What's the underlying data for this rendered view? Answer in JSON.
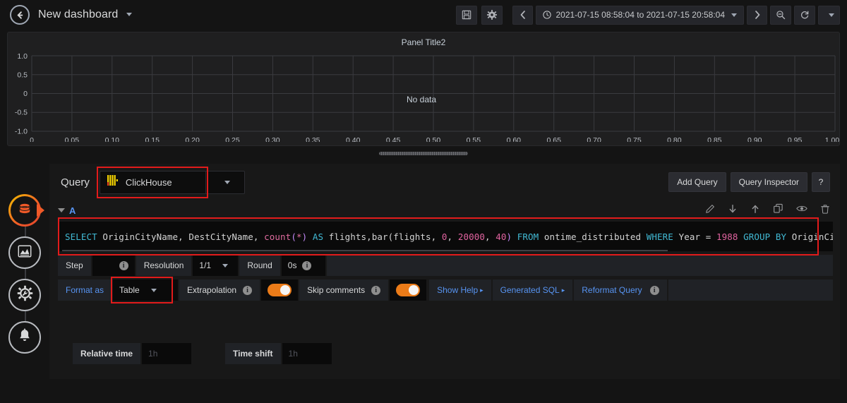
{
  "navbar": {
    "back_icon": "arrow-left-circle-icon",
    "dashboard_title": "New dashboard",
    "save_icon": "save-disk-icon",
    "settings_icon": "gear-icon",
    "prev_range_icon": "chevron-left-icon",
    "next_range_icon": "chevron-right-icon",
    "zoom_out_icon": "search-minus-icon",
    "refresh_icon": "refresh-icon",
    "refresh_caret_icon": "chevron-down-icon",
    "time_range": "2021-07-15 08:58:04 to 2021-07-15 20:58:04",
    "time_icon": "clock-icon"
  },
  "panel": {
    "title": "Panel Title2",
    "nodata": "No data"
  },
  "chart_data": {
    "type": "line",
    "title": "Panel Title2",
    "series": [],
    "x": [],
    "xlabel": "",
    "ylabel": "",
    "xlim": [
      0,
      1.0
    ],
    "ylim": [
      -1.0,
      1.0
    ],
    "xticks": [
      "0",
      "0.05",
      "0.10",
      "0.15",
      "0.20",
      "0.25",
      "0.30",
      "0.35",
      "0.40",
      "0.45",
      "0.50",
      "0.55",
      "0.60",
      "0.65",
      "0.70",
      "0.75",
      "0.80",
      "0.85",
      "0.90",
      "0.95",
      "1.00"
    ],
    "yticks": [
      "1.0",
      "0.5",
      "0",
      "-0.5",
      "-1.0"
    ],
    "grid": true,
    "legend": "none",
    "annotation": "No data"
  },
  "rail": {
    "items": [
      {
        "icon": "database-icon",
        "name": "queries-tab",
        "active": true
      },
      {
        "icon": "visualization-chart-icon",
        "name": "visualization-tab",
        "active": false
      },
      {
        "icon": "gear-wrench-icon",
        "name": "general-settings-tab",
        "active": false
      },
      {
        "icon": "bell-icon",
        "name": "alert-tab",
        "active": false
      }
    ]
  },
  "query": {
    "label": "Query",
    "datasource": "ClickHouse",
    "datasource_icon": "clickhouse-logo-icon",
    "datasource_caret_icon": "chevron-down-icon",
    "add_query": "Add Query",
    "query_inspector": "Query Inspector",
    "help": "?",
    "row": {
      "name": "A",
      "collapse_icon": "chevron-down-icon",
      "actions": [
        {
          "icon": "pencil-icon",
          "name": "edit-query-icon"
        },
        {
          "icon": "arrow-down-icon",
          "name": "move-query-down-icon"
        },
        {
          "icon": "arrow-up-icon",
          "name": "move-query-up-icon"
        },
        {
          "icon": "copy-icon",
          "name": "duplicate-query-icon"
        },
        {
          "icon": "eye-icon",
          "name": "toggle-query-visibility-icon"
        },
        {
          "icon": "trash-icon",
          "name": "delete-query-icon"
        }
      ]
    },
    "sql": {
      "full_text": "SELECT OriginCityName, DestCityName, count(*) AS flights,bar(flights, 0, 20000, 40) FROM ontime_distributed WHERE Year = 1988 GROUP BY OriginCityName, DestCityN",
      "tokens": [
        {
          "t": "SELECT",
          "c": "kw"
        },
        {
          "t": " OriginCityName, DestCityName, ",
          "c": "id"
        },
        {
          "t": "count",
          "c": "fn"
        },
        {
          "t": "(",
          "c": "punct"
        },
        {
          "t": "*",
          "c": "fn"
        },
        {
          "t": ")",
          "c": "punct"
        },
        {
          "t": " ",
          "c": "id"
        },
        {
          "t": "AS",
          "c": "kw"
        },
        {
          "t": " flights,bar(flights, ",
          "c": "id"
        },
        {
          "t": "0",
          "c": "num"
        },
        {
          "t": ", ",
          "c": "id"
        },
        {
          "t": "20000",
          "c": "num"
        },
        {
          "t": ", ",
          "c": "id"
        },
        {
          "t": "40",
          "c": "num"
        },
        {
          "t": ")",
          "c": "punct"
        },
        {
          "t": " ",
          "c": "id"
        },
        {
          "t": "FROM",
          "c": "kw"
        },
        {
          "t": " ontime_distributed ",
          "c": "id"
        },
        {
          "t": "WHERE",
          "c": "kw"
        },
        {
          "t": " Year = ",
          "c": "id"
        },
        {
          "t": "1988",
          "c": "num"
        },
        {
          "t": " ",
          "c": "id"
        },
        {
          "t": "GROUP",
          "c": "kw"
        },
        {
          "t": " ",
          "c": "id"
        },
        {
          "t": "BY",
          "c": "kw"
        },
        {
          "t": " OriginCityName, DestCityN",
          "c": "id"
        }
      ]
    },
    "options": {
      "step_label": "Step",
      "step_value": "",
      "resolution_label": "Resolution",
      "resolution_value": "1/1",
      "round_label": "Round",
      "round_value": "0s",
      "format_as_label": "Format as",
      "format_as_value": "Table",
      "extrapolation_label": "Extrapolation",
      "extrapolation_on": true,
      "skip_comments_label": "Skip comments",
      "skip_comments_on": true,
      "show_help": "Show Help",
      "generated_sql": "Generated SQL",
      "reformat_query": "Reformat Query"
    }
  },
  "bottom": {
    "relative_time_label": "Relative time",
    "relative_time_placeholder": "1h",
    "time_shift_label": "Time shift",
    "time_shift_placeholder": "1h"
  },
  "colors": {
    "accent_blue": "#5794f2",
    "toggle_orange": "#eb7b18",
    "highlight_red": "#e21b1b",
    "clickhouse_yellow": "#f5d300",
    "clickhouse_red": "#e8401a"
  }
}
